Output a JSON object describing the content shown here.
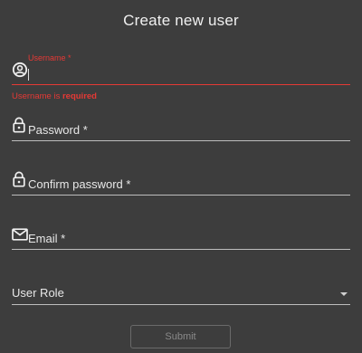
{
  "dialog": {
    "title": "Create new user"
  },
  "form": {
    "username": {
      "label": "Username *",
      "value": "",
      "error_prefix": "Username is ",
      "error_strong": "required"
    },
    "password": {
      "label": "Password *",
      "value": ""
    },
    "confirm_password": {
      "label": "Confirm password *",
      "value": ""
    },
    "email": {
      "label": "Email *",
      "value": ""
    },
    "user_role": {
      "label": "User Role",
      "value": ""
    },
    "submit_label": "Submit"
  },
  "colors": {
    "background": "#3d3d3d",
    "error": "#e53935",
    "underline": "#bdbdbd",
    "text": "#e8e8e8",
    "disabled": "#8a8a8a"
  },
  "icons": {
    "username": "account-circle-icon",
    "password": "lock-icon",
    "confirm_password": "lock-icon",
    "email": "envelope-icon",
    "user_role": "dropdown-arrow-icon"
  }
}
